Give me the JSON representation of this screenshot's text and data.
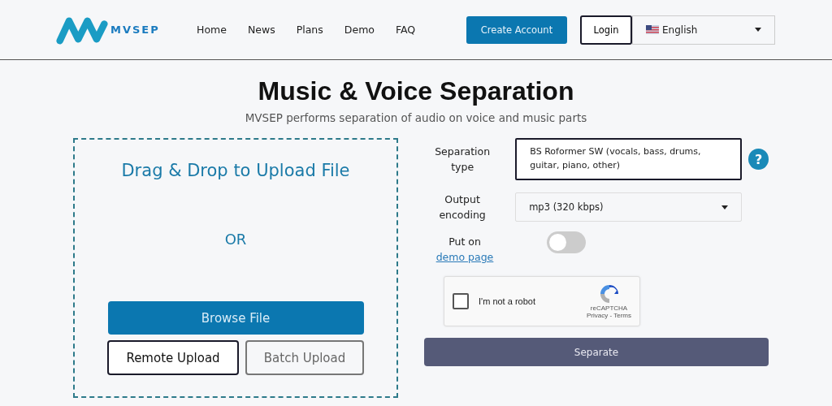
{
  "header": {
    "logo_text": "MVSEP",
    "nav": [
      {
        "label": "Home"
      },
      {
        "label": "News"
      },
      {
        "label": "Plans"
      },
      {
        "label": "Demo"
      },
      {
        "label": "FAQ"
      }
    ],
    "create_account": "Create Account",
    "login": "Login",
    "language": "English"
  },
  "title": "Music & Voice Separation",
  "subtitle": "MVSEP performs separation of audio on voice and music parts",
  "upload": {
    "heading": "Drag & Drop to Upload File",
    "or": "OR",
    "browse": "Browse File",
    "buttons": [
      {
        "label": "Remote Upload",
        "disabled": false
      },
      {
        "label": "Batch Upload",
        "disabled": true
      }
    ]
  },
  "form": {
    "separation_label": "Separation type",
    "separation_value": "BS Roformer SW (vocals, bass, drums, guitar, piano, other)",
    "help": "?",
    "encoding_label": "Output encoding",
    "encoding_value": "mp3 (320 kbps)",
    "demo_label": "Put on",
    "demo_link": "demo page",
    "demo_on": false
  },
  "captcha": {
    "checked": false,
    "label": "I'm not a robot",
    "brand": "reCAPTCHA",
    "links": "Privacy - Terms"
  },
  "separate": "Separate"
}
